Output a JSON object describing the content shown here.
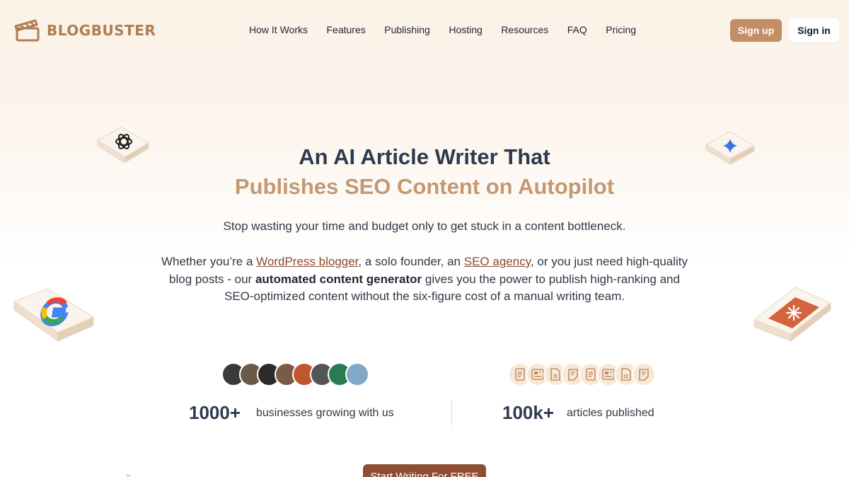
{
  "brand": {
    "name": "BLOGBUSTER",
    "logo_icon": "clapperboard-icon",
    "color": "#b07d55"
  },
  "nav": [
    {
      "label": "How It Works"
    },
    {
      "label": "Features"
    },
    {
      "label": "Publishing"
    },
    {
      "label": "Hosting"
    },
    {
      "label": "Resources"
    },
    {
      "label": "FAQ"
    },
    {
      "label": "Pricing"
    }
  ],
  "header": {
    "signup_label": "Sign up",
    "signin_label": "Sign in"
  },
  "hero": {
    "title_line1": "An AI Article Writer That",
    "title_line2": "Publishes SEO Content on Autopilot",
    "subtitle": "Stop wasting your time and budget only to get stuck in a content bottleneck.",
    "p_pre": "Whether you’re a ",
    "p_link1": "WordPress blogger",
    "p_mid1": ", a solo founder, an ",
    "p_link2": "SEO agency",
    "p_mid2": ", or you just need high-quality blog posts - our ",
    "p_bold": "automated content generator",
    "p_post": " gives you the power to publish high-ranking and SEO-optimized content without the six-figure cost of a manual writing team."
  },
  "floating_icons": [
    "openai-icon",
    "gemini-icon",
    "google-icon",
    "claude-icon"
  ],
  "stats": {
    "businesses_value": "1000+",
    "businesses_label": "businesses growing with us",
    "articles_value": "100k+",
    "articles_label": "articles published",
    "avatar_colors": [
      "#3a3a3a",
      "#6b5a4a",
      "#2b2b2b",
      "#7a5c46",
      "#c0562d",
      "#555555",
      "#2a7a54",
      "#7fa8c9"
    ],
    "doc_icons": [
      "text-doc-icon",
      "layout-doc-icon",
      "file-doc-icon",
      "note-doc-icon",
      "text-doc-icon",
      "layout-doc-icon",
      "file-doc-icon",
      "note-doc-icon"
    ]
  },
  "cta": {
    "label": "Start Writing For FREE"
  },
  "colors": {
    "accent": "#c28e66",
    "cta": "#8f4d33",
    "heading": "#2f3a4f",
    "heading_accent": "#c49872"
  }
}
